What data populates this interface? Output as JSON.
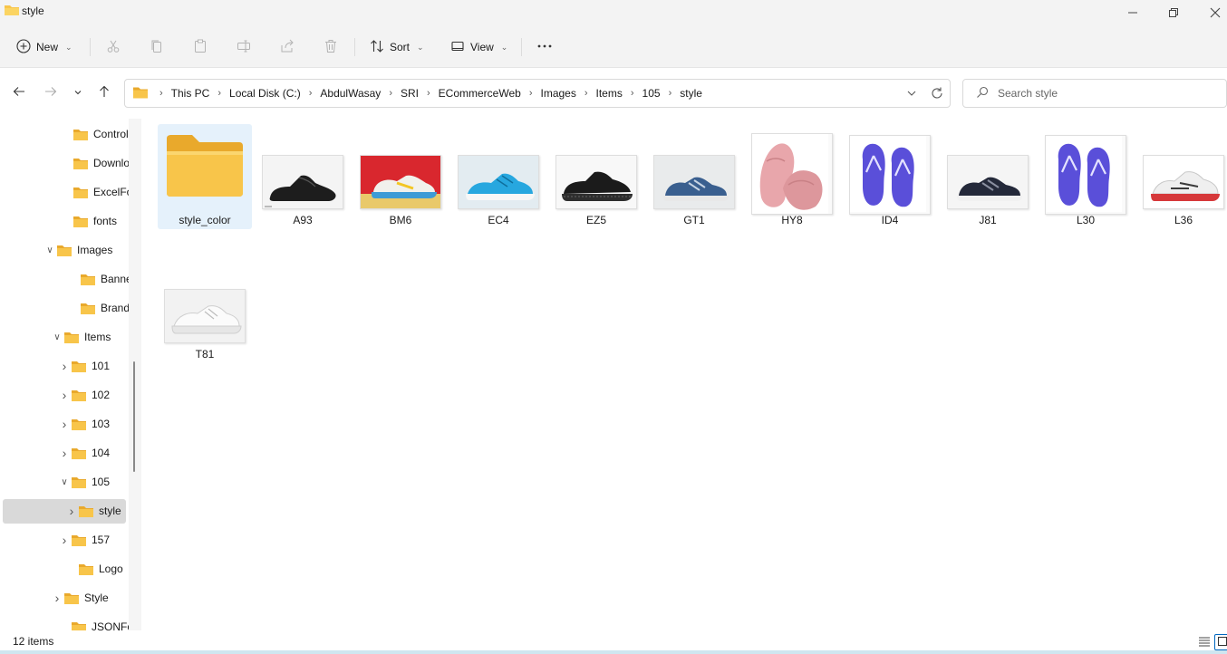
{
  "window": {
    "title": "style"
  },
  "toolbar": {
    "new_label": "New",
    "sort_label": "Sort",
    "view_label": "View"
  },
  "address": {
    "crumbs": [
      "This PC",
      "Local Disk (C:)",
      "AbdulWasay",
      "SRI",
      "ECommerceWeb",
      "Images",
      "Items",
      "105",
      "style"
    ]
  },
  "search": {
    "placeholder": "Search style"
  },
  "sidebar": {
    "items": [
      {
        "label": "Controlle",
        "expand": ""
      },
      {
        "label": "Downloa",
        "expand": ""
      },
      {
        "label": "ExcelForr",
        "expand": ""
      },
      {
        "label": "fonts",
        "expand": ""
      },
      {
        "label": "Images",
        "expand": "expanded"
      },
      {
        "label": "Banner",
        "expand": ""
      },
      {
        "label": "Brand",
        "expand": ""
      },
      {
        "label": "Items",
        "expand": "expanded"
      },
      {
        "label": "101",
        "expand": "collapsed"
      },
      {
        "label": "102",
        "expand": "collapsed"
      },
      {
        "label": "103",
        "expand": "collapsed"
      },
      {
        "label": "104",
        "expand": "collapsed"
      },
      {
        "label": "105",
        "expand": "expanded"
      },
      {
        "label": "style",
        "expand": "collapsed"
      },
      {
        "label": "157",
        "expand": "collapsed"
      },
      {
        "label": "Logo",
        "expand": ""
      },
      {
        "label": "Style",
        "expand": "collapsed"
      },
      {
        "label": "JSONForr",
        "expand": ""
      }
    ],
    "selected": "style"
  },
  "files": [
    {
      "name": "style_color",
      "kind": "folder"
    },
    {
      "name": "A93",
      "kind": "image",
      "icon": "black-dress-shoe"
    },
    {
      "name": "BM6",
      "kind": "image",
      "icon": "colorful-sneaker"
    },
    {
      "name": "EC4",
      "kind": "image",
      "icon": "blue-running-shoe"
    },
    {
      "name": "EZ5",
      "kind": "image",
      "icon": "black-derby-shoe"
    },
    {
      "name": "GT1",
      "kind": "image",
      "icon": "navy-sneaker"
    },
    {
      "name": "HY8",
      "kind": "image",
      "icon": "pink-fur-slipper"
    },
    {
      "name": "ID4",
      "kind": "image",
      "icon": "purple-flip-flops"
    },
    {
      "name": "J81",
      "kind": "image",
      "icon": "dark-sneaker"
    },
    {
      "name": "L30",
      "kind": "image",
      "icon": "purple-flip-flops"
    },
    {
      "name": "L36",
      "kind": "image",
      "icon": "white-red-sneaker"
    },
    {
      "name": "T81",
      "kind": "image",
      "icon": "white-sneaker"
    }
  ],
  "status": {
    "count": "12 items"
  },
  "colors": {
    "folder": "#f8c54a",
    "folder_dark": "#e9a92c",
    "selection": "#e5f1fb",
    "sidebar_selection": "#d9d9d9"
  }
}
